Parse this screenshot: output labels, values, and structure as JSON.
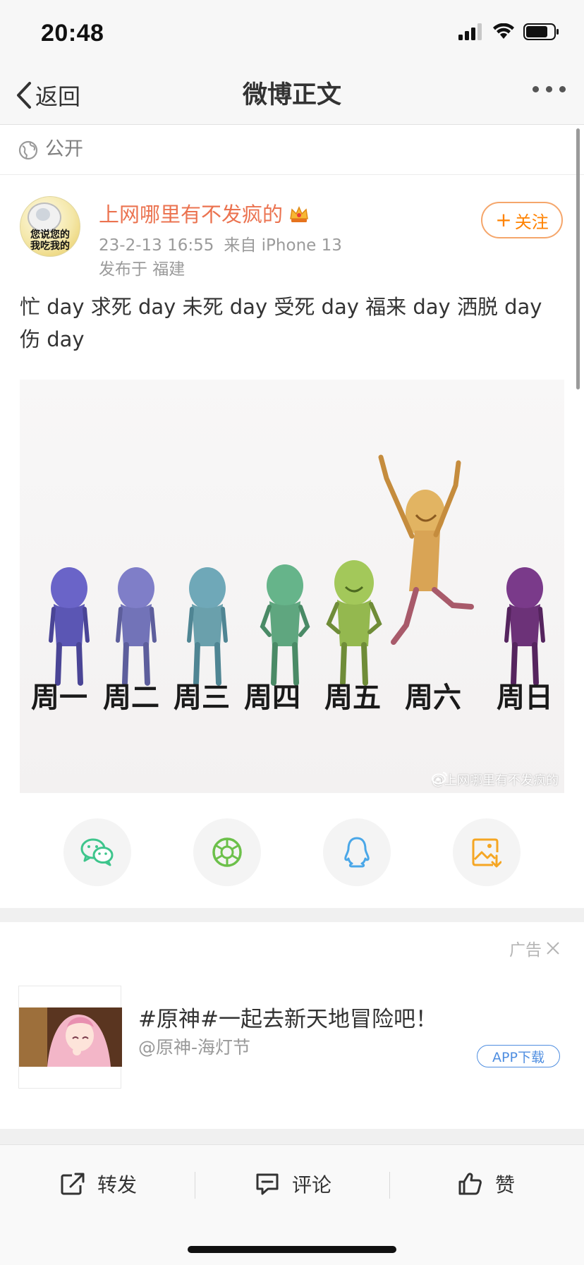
{
  "status_bar": {
    "time": "20:48"
  },
  "nav": {
    "back_label": "返回",
    "title": "微博正文"
  },
  "visibility": {
    "label": "公开"
  },
  "author": {
    "avatar_text_line1": "您说您的",
    "avatar_text_line2": "我吃我的",
    "name": "上网哪里有不发疯的",
    "timestamp": "23-2-13 16:55",
    "source": "来自 iPhone 13",
    "location": "发布于 福建",
    "follow_label": "关注"
  },
  "post": {
    "text": "忙 day 求死 day 未死 day 受死 day 福来 day 洒脱 day 伤 day",
    "image_captions": [
      "周一",
      "周二",
      "周三",
      "周四",
      "周五",
      "周六",
      "周日"
    ],
    "watermark": "@上网哪里有不发疯的"
  },
  "share_buttons": [
    "wechat-icon",
    "moments-icon",
    "qq-icon",
    "save-image-icon"
  ],
  "ad": {
    "label": "广告",
    "title": "#原神#一起去新天地冒险吧！",
    "subtitle": "@原神-海灯节",
    "button_label": "APP下载"
  },
  "toolbar": {
    "repost_label": "转发",
    "comment_label": "评论",
    "like_label": "赞"
  },
  "colors": {
    "accent_orange": "#ff8200",
    "username_orange": "#eb7350",
    "ad_blue": "#4f8ee0",
    "wechat_green": "#3ec58c",
    "qq_blue": "#4aa7e8",
    "save_orange": "#f5a623"
  }
}
